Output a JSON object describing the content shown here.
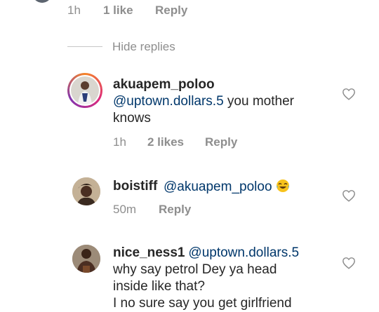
{
  "top_comment": {
    "time": "1h",
    "likes": "1 like",
    "reply": "Reply"
  },
  "hide_replies": "Hide replies",
  "replies": [
    {
      "username": "akuapem_poloo",
      "mention": "@uptown.dollars.5",
      "text_line1": " you mother",
      "text_line2": "knows",
      "time": "1h",
      "likes": "2 likes",
      "reply": "Reply"
    },
    {
      "username": "boistiff",
      "mention": "@akuapem_poloo",
      "emoji": "😂",
      "time": "50m",
      "reply": "Reply"
    },
    {
      "username": "nice_ness1",
      "mention": "@uptown.dollars.5",
      "text_line1": "why say petrol Dey ya head",
      "text_line2": "inside like that?",
      "text_line3": "I no sure say you get girlfriend"
    }
  ],
  "icons": {
    "like": "heart-outline-icon",
    "story_ring_colors": [
      "#f58529",
      "#dd2a7b",
      "#8134af"
    ]
  }
}
